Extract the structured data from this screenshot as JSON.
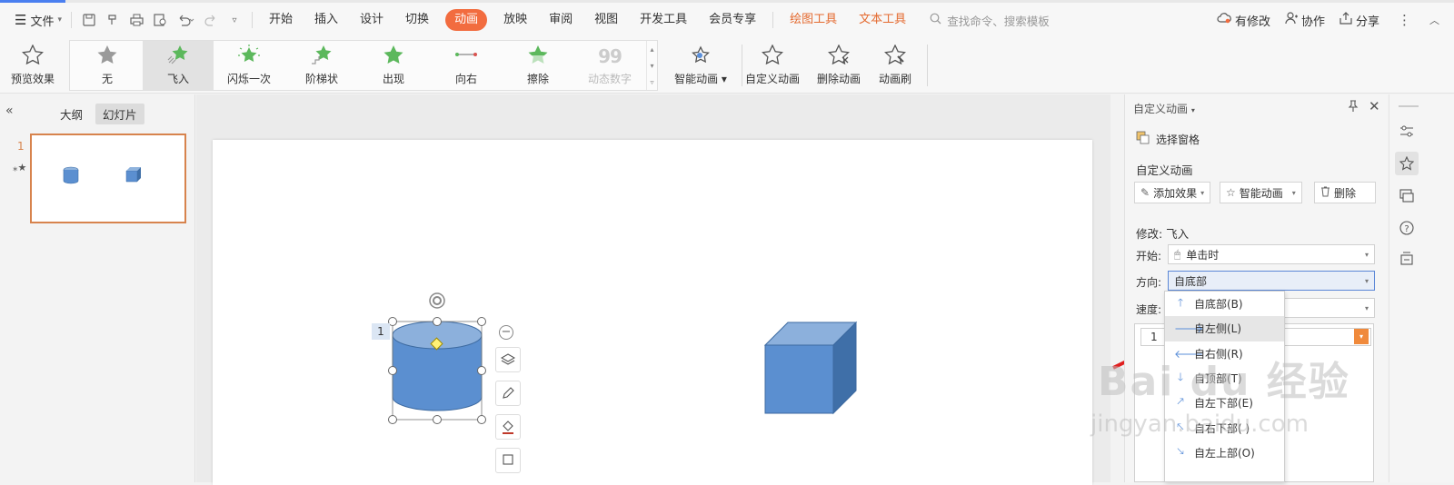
{
  "menubar": {
    "file_label": "文件",
    "tabs": [
      {
        "label": "开始"
      },
      {
        "label": "插入"
      },
      {
        "label": "设计"
      },
      {
        "label": "切换"
      },
      {
        "label": "动画"
      },
      {
        "label": "放映"
      },
      {
        "label": "审阅"
      },
      {
        "label": "视图"
      },
      {
        "label": "开发工具"
      },
      {
        "label": "会员专享"
      }
    ],
    "context_tabs": [
      {
        "label": "绘图工具"
      },
      {
        "label": "文本工具"
      }
    ],
    "search_placeholder": "查找命令、搜索模板",
    "right": {
      "modified": "有修改",
      "collab": "协作",
      "share": "分享"
    },
    "active_color": "#f26c3f",
    "context_color": "#e46a2f"
  },
  "ribbon": {
    "preview": "预览效果",
    "gallery": [
      {
        "label": "无",
        "icon": "star-gray-icon"
      },
      {
        "label": "飞入",
        "icon": "fly-in-star-icon"
      },
      {
        "label": "闪烁一次",
        "icon": "flash-star-icon"
      },
      {
        "label": "阶梯状",
        "icon": "stairs-star-icon"
      },
      {
        "label": "出现",
        "icon": "appear-star-icon"
      },
      {
        "label": "向右",
        "icon": "path-right-icon"
      },
      {
        "label": "擦除",
        "icon": "wipe-star-icon"
      },
      {
        "label": "动态数字",
        "icon": "dynamic-number-icon"
      }
    ],
    "smart_animation": "智能动画",
    "custom_animation": "自定义动画",
    "delete_animation": "删除动画",
    "animation_painter": "动画刷"
  },
  "left_panel": {
    "tab_outline": "大纲",
    "tab_slides": "幻灯片",
    "slide_number": "1"
  },
  "slide": {
    "anim_badge": "1"
  },
  "right_panel": {
    "title": "自定义动画",
    "select_pane": "选择窗格",
    "section_title": "自定义动画",
    "add_effect": "添加效果",
    "smart_animation": "智能动画",
    "delete": "删除",
    "modify_label": "修改: 飞入",
    "start_label": "开始:",
    "start_value": "单击时",
    "direction_label": "方向:",
    "direction_value": "自底部",
    "speed_label": "速度:",
    "list_item_number": "1"
  },
  "direction_dropdown": {
    "items": [
      {
        "label": "自底部(B)",
        "icon": "arrow-up-icon"
      },
      {
        "label": "自左侧(L)",
        "icon": "arrow-right-icon"
      },
      {
        "label": "自右侧(R)",
        "icon": "arrow-left-icon"
      },
      {
        "label": "自顶部(T)",
        "icon": "arrow-down-icon"
      },
      {
        "label": "自左下部(E)",
        "icon": "arrow-up-right-icon"
      },
      {
        "label": "自右下部( )",
        "icon": "arrow-up-left-icon"
      },
      {
        "label": "自左上部(O)",
        "icon": "arrow-down-right-icon"
      }
    ],
    "highlighted_index": 1
  },
  "watermark": {
    "logo": "Bai du 经验",
    "url": "jingyan.baidu.com"
  }
}
